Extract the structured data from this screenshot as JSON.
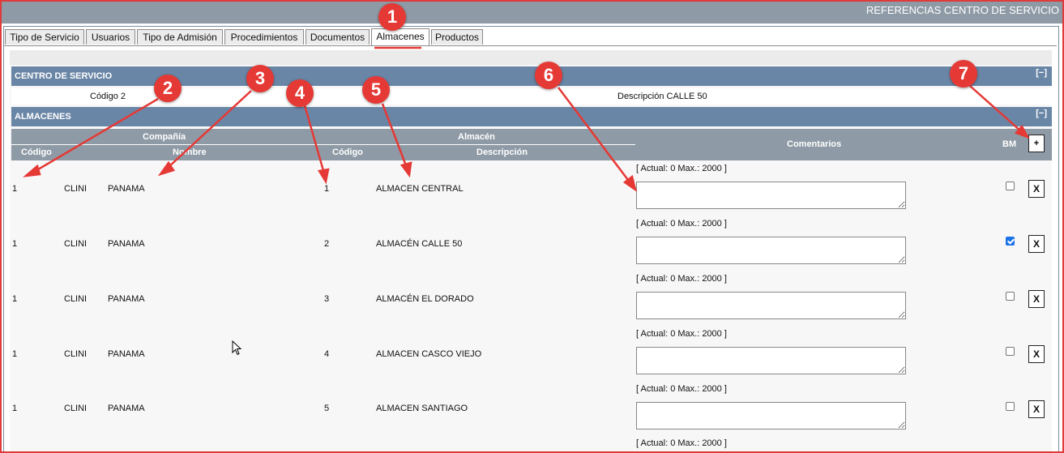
{
  "header": {
    "title": "REFERENCIAS CENTRO DE SERVICIO"
  },
  "tabs": [
    {
      "label": "Tipo de Servicio"
    },
    {
      "label": "Usuarios"
    },
    {
      "label": "Tipo de Admisión"
    },
    {
      "label": "Procedimientos"
    },
    {
      "label": "Documentos"
    },
    {
      "label": "Almacenes"
    },
    {
      "label": "Productos"
    }
  ],
  "active_tab": "Almacenes",
  "centro": {
    "section_title": "CENTRO DE SERVICIO",
    "collapse_label": "[−]",
    "codigo_text": "Código 2",
    "descripcion_text": "Descripción CALLE 50"
  },
  "almacenes": {
    "section_title": "ALMACENES",
    "collapse_label": "[−]",
    "headers": {
      "compania": "Compañía",
      "almacen": "Almacén",
      "codigo": "Código",
      "nombre": "Nombre",
      "codigo2": "Código",
      "descripcion": "Descripción",
      "comentarios": "Comentarios",
      "bm": "BM",
      "add": "+"
    },
    "counter_text": "[ Actual: 0   Max.: 2000 ]",
    "delete_label": "X",
    "rows": [
      {
        "codigo": "1",
        "compania": "CLINI",
        "nombre": "PANAMA",
        "alm_codigo": "1",
        "descripcion": "ALMACEN CENTRAL",
        "comentario": "",
        "bm": false
      },
      {
        "codigo": "1",
        "compania": "CLINI",
        "nombre": "PANAMA",
        "alm_codigo": "2",
        "descripcion": "ALMACÉN CALLE 50",
        "comentario": "",
        "bm": true
      },
      {
        "codigo": "1",
        "compania": "CLINI",
        "nombre": "PANAMA",
        "alm_codigo": "3",
        "descripcion": "ALMACÉN EL DORADO",
        "comentario": "",
        "bm": false
      },
      {
        "codigo": "1",
        "compania": "CLINI",
        "nombre": "PANAMA",
        "alm_codigo": "4",
        "descripcion": "ALMACEN CASCO VIEJO",
        "comentario": "",
        "bm": false
      },
      {
        "codigo": "1",
        "compania": "CLINI",
        "nombre": "PANAMA",
        "alm_codigo": "5",
        "descripcion": "ALMACEN SANTIAGO",
        "comentario": "",
        "bm": false
      }
    ]
  },
  "annotations": [
    "1",
    "2",
    "3",
    "4",
    "5",
    "6",
    "7"
  ],
  "colors": {
    "accent_red": "#e53935",
    "section_blue": "#6a86a6",
    "header_grey": "#8e9aa5"
  }
}
